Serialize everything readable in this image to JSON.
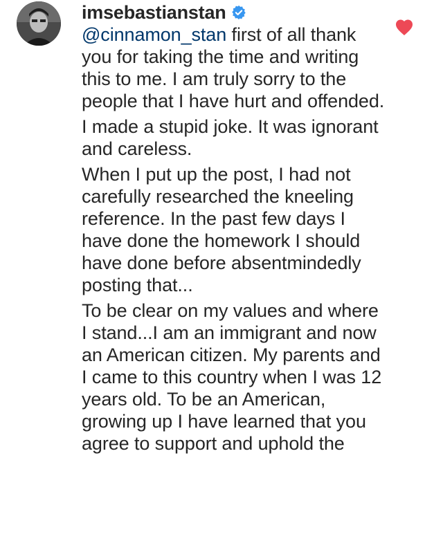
{
  "comment": {
    "username": "imsebastianstan",
    "mention": "@cinnamon_stan",
    "paragraphs": [
      " first of all thank you for taking the time and writing this to me. I am truly sorry to the people that I have hurt and offended.",
      "I made a stupid joke. It was ignorant and careless.",
      "When I put up the post, I had not carefully researched the kneeling reference.  In the past few days I have done the homework I should have done before absentmindedly posting that...",
      "To be clear on my values and where I stand...I am an immigrant and now an American citizen.  My parents and I came to this country when I was 12 years old.  To be an American, growing up I have learned that you agree to support and uphold the"
    ]
  },
  "icons": {
    "verified": "verified-badge-icon",
    "like": "heart-icon",
    "like_color": "#ed4956",
    "verified_color": "#3897f0"
  }
}
